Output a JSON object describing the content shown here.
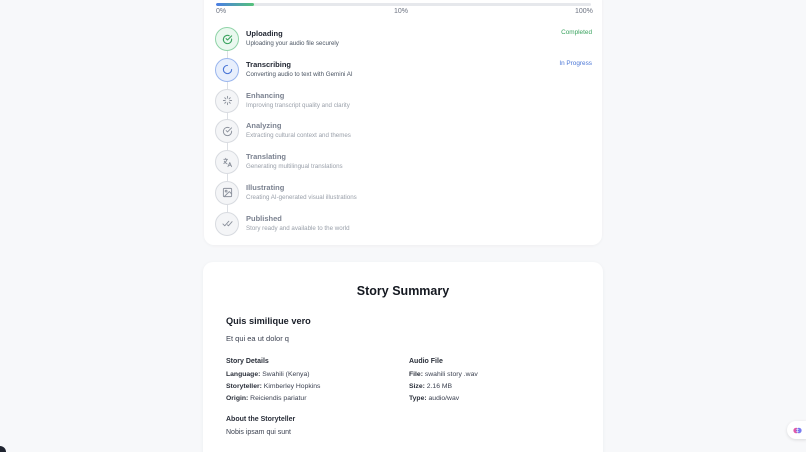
{
  "progress": {
    "value_percent": 10,
    "labels": {
      "start": "0%",
      "mid": "10%",
      "end": "100%"
    }
  },
  "steps": [
    {
      "title": "Uploading",
      "desc": "Uploading your audio file securely",
      "status": "Completed",
      "state": "done",
      "icon": "check-circle-icon"
    },
    {
      "title": "Transcribing",
      "desc": "Converting audio to text with Gemini AI",
      "status": "In Progress",
      "state": "active",
      "icon": "spinner-icon"
    },
    {
      "title": "Enhancing",
      "desc": "Improving transcript quality and clarity",
      "status": "",
      "state": "pending",
      "icon": "sparkle-icon"
    },
    {
      "title": "Analyzing",
      "desc": "Extracting cultural context and themes",
      "status": "",
      "state": "pending",
      "icon": "check-circle-icon"
    },
    {
      "title": "Translating",
      "desc": "Generating multilingual translations",
      "status": "",
      "state": "pending",
      "icon": "translate-icon"
    },
    {
      "title": "Illustrating",
      "desc": "Creating AI-generated visual illustrations",
      "status": "",
      "state": "pending",
      "icon": "image-icon"
    },
    {
      "title": "Published",
      "desc": "Story ready and available to the world",
      "status": "",
      "state": "pending",
      "icon": "double-check-icon"
    }
  ],
  "summary": {
    "title": "Story Summary",
    "story_title": "Quis similique vero",
    "story_subtitle": "Et qui ea ut dolor q",
    "details": {
      "heading": "Story Details",
      "language_label": "Language:",
      "language": "Swahili (Kenya)",
      "storyteller_label": "Storyteller:",
      "storyteller": "Kimberley Hopkins",
      "origin_label": "Origin:",
      "origin": "Reiciendis pariatur"
    },
    "audio": {
      "heading": "Audio File",
      "file_label": "File:",
      "file": "swahili story .wav",
      "size_label": "Size:",
      "size": "2.16 MB",
      "type_label": "Type:",
      "type": "audio/wav"
    },
    "about": {
      "heading": "About the Storyteller",
      "text": "Nobis ipsam qui sunt"
    }
  },
  "colors": {
    "completed": "#3aa35f",
    "in_progress": "#4a76d6",
    "bar_start": "#4a7de6",
    "bar_end": "#55c27a"
  }
}
